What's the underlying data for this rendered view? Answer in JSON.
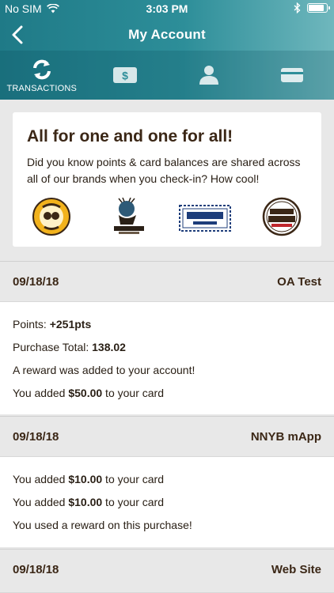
{
  "status_bar": {
    "carrier": "No SIM",
    "time": "3:03 PM"
  },
  "nav": {
    "title": "My Account"
  },
  "tabs": [
    {
      "label": "TRANSACTIONS",
      "icon": "refresh-icon"
    },
    {
      "label": "",
      "icon": "money-icon"
    },
    {
      "label": "",
      "icon": "person-icon"
    },
    {
      "label": "",
      "icon": "card-icon"
    }
  ],
  "promo": {
    "title": "All for one and one for all!",
    "text": "Did you know points & card balances are shared across all of our brands when you check-in? How cool!",
    "brands": [
      "Einstein Bros Bagels",
      "Caribou Coffee",
      "Noah's NY Bagels",
      "Bruegger's Bagels"
    ]
  },
  "transactions": [
    {
      "date": "09/18/18",
      "location": "OA Test",
      "lines": [
        {
          "pre": "Points: ",
          "bold": "+251pts",
          "post": ""
        },
        {
          "pre": "Purchase Total: ",
          "bold": "138.02",
          "post": ""
        },
        {
          "pre": "A reward was added to your account!",
          "bold": "",
          "post": ""
        },
        {
          "pre": "You added ",
          "bold": "$50.00",
          "post": " to your card"
        }
      ]
    },
    {
      "date": "09/18/18",
      "location": "NNYB mApp",
      "lines": [
        {
          "pre": "You added ",
          "bold": "$10.00",
          "post": " to your card"
        },
        {
          "pre": "You added ",
          "bold": "$10.00",
          "post": " to your card"
        },
        {
          "pre": "You used a reward on this purchase!",
          "bold": "",
          "post": ""
        }
      ]
    },
    {
      "date": "09/18/18",
      "location": "Web Site",
      "lines": []
    }
  ],
  "colors": {
    "header_teal": "#2d8e99",
    "text_brown": "#3b2716"
  }
}
